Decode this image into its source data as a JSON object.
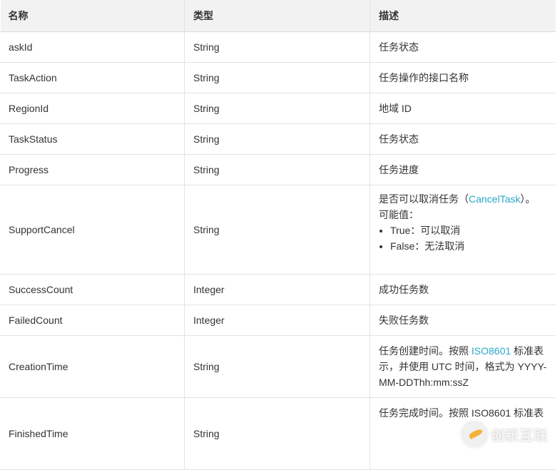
{
  "headers": [
    "名称",
    "类型",
    "描述"
  ],
  "rows": [
    {
      "name": "askId",
      "type": "String",
      "desc": "任务状态"
    },
    {
      "name": "TaskAction",
      "type": "String",
      "desc": "任务操作的接口名称"
    },
    {
      "name": "RegionId",
      "type": "String",
      "desc": "地域 ID"
    },
    {
      "name": "TaskStatus",
      "type": "String",
      "desc": "任务状态"
    },
    {
      "name": "Progress",
      "type": "String",
      "desc": "任务进度"
    },
    {
      "name": "SupportCancel",
      "type": "String",
      "desc_pre": "是否可以取消任务（",
      "desc_link": "CancelTask",
      "desc_post": "）。",
      "desc_line2": "可能值：",
      "options": [
        "True：可以取消",
        "False：无法取消"
      ]
    },
    {
      "name": "SuccessCount",
      "type": "Integer",
      "desc": "成功任务数"
    },
    {
      "name": "FailedCount",
      "type": "Integer",
      "desc": "失败任务数"
    },
    {
      "name": "CreationTime",
      "type": "String",
      "desc_pre": "任务创建时间。按照 ",
      "desc_link": "ISO8601",
      "desc_post": " 标准表示，并使用 UTC 时间，格式为 YYYY-MM-DDThh:mm:ssZ"
    },
    {
      "name": "FinishedTime",
      "type": "String",
      "desc": "任务完成时间。按照 ISO8601 标准表"
    }
  ],
  "watermark": "创新互联",
  "link_color": "#2aa7c9"
}
